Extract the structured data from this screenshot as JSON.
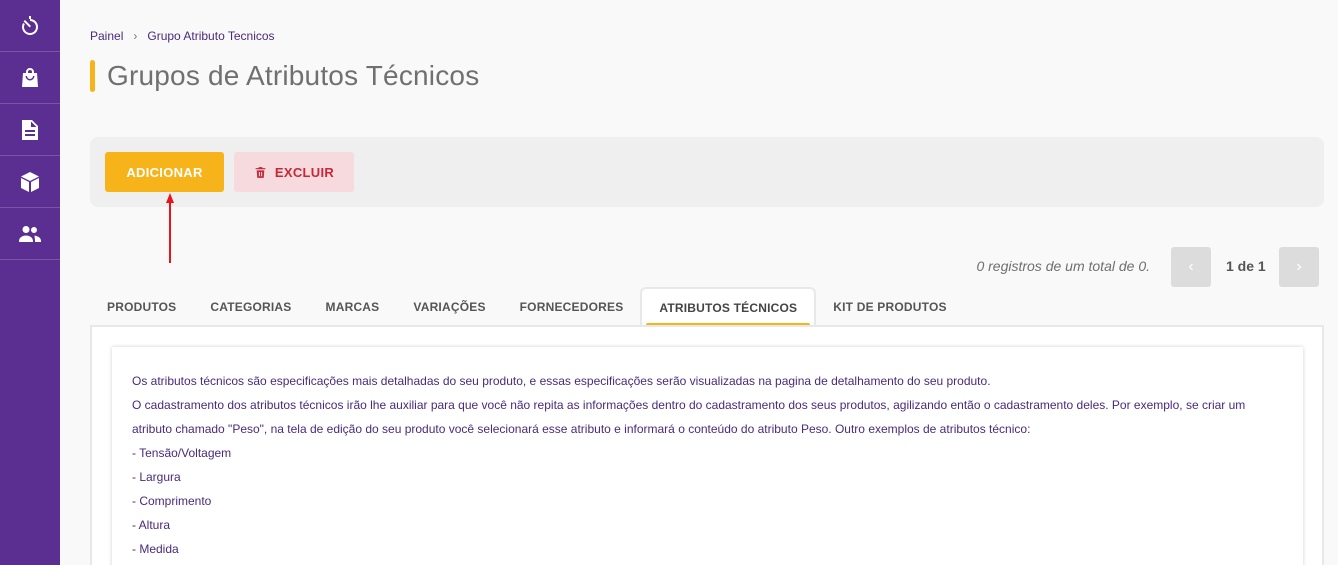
{
  "sidebar": {
    "items": [
      {
        "icon": "timer-icon"
      },
      {
        "icon": "shopping-bag-icon"
      },
      {
        "icon": "document-icon"
      },
      {
        "icon": "package-icon"
      },
      {
        "icon": "people-icon"
      }
    ]
  },
  "breadcrumb": {
    "home": "Painel",
    "separator": "›",
    "current": "Grupo Atributo Tecnicos"
  },
  "page": {
    "title": "Grupos de Atributos Técnicos"
  },
  "toolbar": {
    "add_label": "ADICIONAR",
    "delete_label": "EXCLUIR"
  },
  "pagination": {
    "records_text": "0 registros de um total de 0.",
    "prev": "‹",
    "page_info": "1 de 1",
    "next": "›"
  },
  "tabs": [
    {
      "label": "PRODUTOS"
    },
    {
      "label": "CATEGORIAS"
    },
    {
      "label": "MARCAS"
    },
    {
      "label": "VARIAÇÕES"
    },
    {
      "label": "FORNECEDORES"
    },
    {
      "label": "ATRIBUTOS TÉCNICOS"
    },
    {
      "label": "KIT DE PRODUTOS"
    }
  ],
  "info": {
    "lines": [
      "Os atributos técnicos são especificações mais detalhadas do seu produto, e essas especificações serão visualizadas na pagina de detalhamento do seu produto.",
      "O cadastramento dos atributos técnicos irão lhe auxiliar para que você não repita as informações dentro do cadastramento dos seus produtos, agilizando então o cadastramento deles. Por exemplo, se criar um atributo chamado \"Peso\", na tela de edição do seu produto você selecionará esse atributo e informará o conteúdo do atributo Peso. Outro exemplos de atributos técnico:",
      "- Tensão/Voltagem",
      "- Largura",
      "- Comprimento",
      "- Altura",
      "- Medida"
    ]
  },
  "colors": {
    "sidebar": "#5b2f91",
    "accent": "#f7b31a",
    "danger": "#c62839",
    "annotation_arrow": "#e8141a"
  }
}
